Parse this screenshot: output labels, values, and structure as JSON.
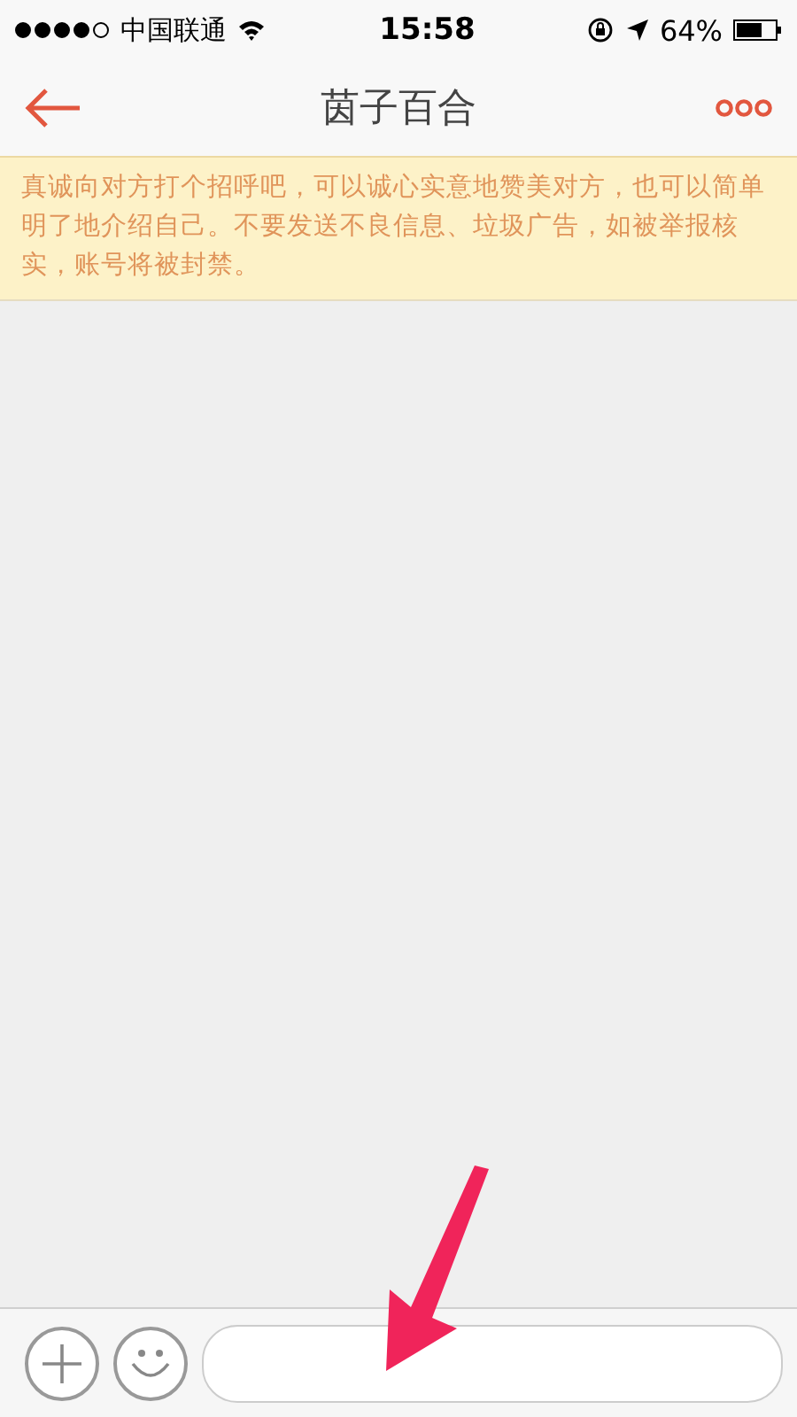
{
  "status_bar": {
    "carrier": "中国联通",
    "time": "15:58",
    "battery": "64%"
  },
  "nav": {
    "title": "茵子百合"
  },
  "notice": {
    "text": "真诚向对方打个招呼吧，可以诚心实意地赞美对方，也可以简单明了地介绍自己。不要发送不良信息、垃圾广告，如被举报核实，账号将被封禁。"
  },
  "annotation": {
    "kind": "arrow"
  }
}
